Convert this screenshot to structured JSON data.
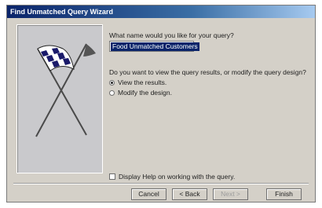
{
  "window": {
    "title": "Find Unmatched Query Wizard"
  },
  "wizard": {
    "name_question": "What name would you like for your query?",
    "query_name": "Food Unmatched Customers",
    "next_question": "Do you want to view the query results, or modify the query design?",
    "options": [
      {
        "label": "View the results.",
        "selected": true
      },
      {
        "label": "Modify the design.",
        "selected": false
      }
    ],
    "help_checkbox": {
      "label": "Display Help on working with the query.",
      "checked": false
    }
  },
  "buttons": {
    "cancel": "Cancel",
    "back": "< Back",
    "next": "Next >",
    "finish": "Finish"
  }
}
